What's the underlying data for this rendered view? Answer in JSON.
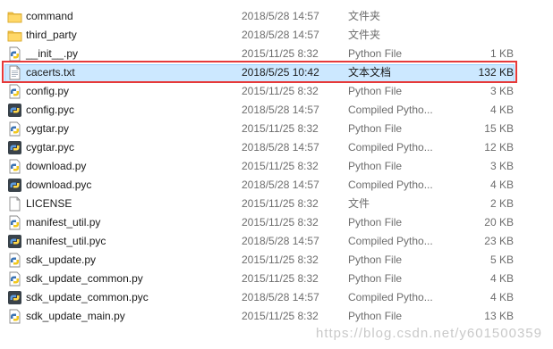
{
  "files": [
    {
      "name": "command",
      "date": "2018/5/28 14:57",
      "type": "文件夹",
      "size": "",
      "icon": "folder-icon"
    },
    {
      "name": "third_party",
      "date": "2018/5/28 14:57",
      "type": "文件夹",
      "size": "",
      "icon": "folder-icon"
    },
    {
      "name": "__init__.py",
      "date": "2015/11/25 8:32",
      "type": "Python File",
      "size": "1 KB",
      "icon": "python-file-icon"
    },
    {
      "name": "cacerts.txt",
      "date": "2018/5/25 10:42",
      "type": "文本文档",
      "size": "132 KB",
      "icon": "text-file-icon",
      "selected": true
    },
    {
      "name": "config.py",
      "date": "2015/11/25 8:32",
      "type": "Python File",
      "size": "3 KB",
      "icon": "python-file-icon"
    },
    {
      "name": "config.pyc",
      "date": "2018/5/28 14:57",
      "type": "Compiled Pytho...",
      "size": "4 KB",
      "icon": "compiled-python-icon"
    },
    {
      "name": "cygtar.py",
      "date": "2015/11/25 8:32",
      "type": "Python File",
      "size": "15 KB",
      "icon": "python-file-icon"
    },
    {
      "name": "cygtar.pyc",
      "date": "2018/5/28 14:57",
      "type": "Compiled Pytho...",
      "size": "12 KB",
      "icon": "compiled-python-icon"
    },
    {
      "name": "download.py",
      "date": "2015/11/25 8:32",
      "type": "Python File",
      "size": "3 KB",
      "icon": "python-file-icon"
    },
    {
      "name": "download.pyc",
      "date": "2018/5/28 14:57",
      "type": "Compiled Pytho...",
      "size": "4 KB",
      "icon": "compiled-python-icon"
    },
    {
      "name": "LICENSE",
      "date": "2015/11/25 8:32",
      "type": "文件",
      "size": "2 KB",
      "icon": "generic-file-icon"
    },
    {
      "name": "manifest_util.py",
      "date": "2015/11/25 8:32",
      "type": "Python File",
      "size": "20 KB",
      "icon": "python-file-icon"
    },
    {
      "name": "manifest_util.pyc",
      "date": "2018/5/28 14:57",
      "type": "Compiled Pytho...",
      "size": "23 KB",
      "icon": "compiled-python-icon"
    },
    {
      "name": "sdk_update.py",
      "date": "2015/11/25 8:32",
      "type": "Python File",
      "size": "5 KB",
      "icon": "python-file-icon"
    },
    {
      "name": "sdk_update_common.py",
      "date": "2015/11/25 8:32",
      "type": "Python File",
      "size": "4 KB",
      "icon": "python-file-icon"
    },
    {
      "name": "sdk_update_common.pyc",
      "date": "2018/5/28 14:57",
      "type": "Compiled Pytho...",
      "size": "4 KB",
      "icon": "compiled-python-icon"
    },
    {
      "name": "sdk_update_main.py",
      "date": "2015/11/25 8:32",
      "type": "Python File",
      "size": "13 KB",
      "icon": "python-file-icon"
    }
  ],
  "watermark": "https://blog.csdn.net/y601500359",
  "colors": {
    "selection": "#cce8ff",
    "selection_border": "#99d1ff",
    "highlight_box": "#e63a3a",
    "folder": "#f4c44e"
  }
}
